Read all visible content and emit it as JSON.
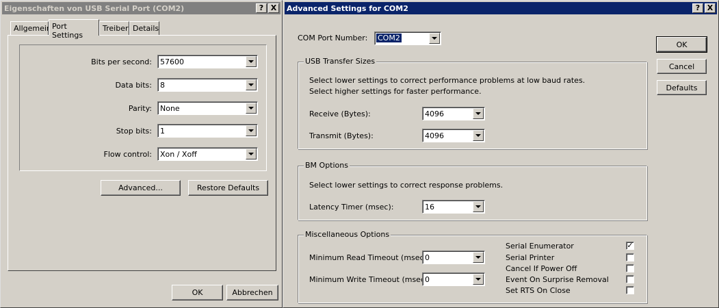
{
  "left_window": {
    "title": "Eigenschaften von USB Serial Port (COM2)",
    "title_help": "?",
    "title_close": "X",
    "tabs": [
      {
        "label": "Allgemein"
      },
      {
        "label": "Port Settings"
      },
      {
        "label": "Treiber"
      },
      {
        "label": "Details"
      }
    ],
    "fields": [
      {
        "label": "Bits per second:",
        "value": "57600"
      },
      {
        "label": "Data bits:",
        "value": "8"
      },
      {
        "label": "Parity:",
        "value": "None"
      },
      {
        "label": "Stop bits:",
        "value": "1"
      },
      {
        "label": "Flow control:",
        "value": "Xon / Xoff"
      }
    ],
    "advanced_label": "Advanced...",
    "restore_label": "Restore Defaults",
    "ok_label": "OK",
    "cancel_label": "Abbrechen"
  },
  "right_window": {
    "title": "Advanced Settings for COM2",
    "title_help": "?",
    "title_close": "X",
    "com_port_label": "COM Port Number:",
    "com_port_value": "COM2",
    "usb_group": {
      "title": "USB Transfer Sizes",
      "desc1": "Select lower settings to correct performance problems at low baud rates.",
      "desc2": "Select higher settings for faster performance.",
      "receive_label": "Receive (Bytes):",
      "receive_value": "4096",
      "transmit_label": "Transmit (Bytes):",
      "transmit_value": "4096"
    },
    "bm_group": {
      "title": "BM Options",
      "desc": "Select lower settings to correct response problems.",
      "latency_label": "Latency Timer (msec):",
      "latency_value": "16"
    },
    "misc_group": {
      "title": "Miscellaneous Options",
      "read_timeout_label": "Minimum Read Timeout (msec):",
      "read_timeout_value": "0",
      "write_timeout_label": "Minimum Write Timeout (msec):",
      "write_timeout_value": "0",
      "options": [
        {
          "label": "Serial Enumerator",
          "checked": "✓"
        },
        {
          "label": "Serial Printer",
          "checked": ""
        },
        {
          "label": "Cancel If Power Off",
          "checked": ""
        },
        {
          "label": "Event On Surprise Removal",
          "checked": ""
        },
        {
          "label": "Set RTS On Close",
          "checked": ""
        }
      ]
    },
    "ok_label": "OK",
    "cancel_label": "Cancel",
    "defaults_label": "Defaults"
  }
}
